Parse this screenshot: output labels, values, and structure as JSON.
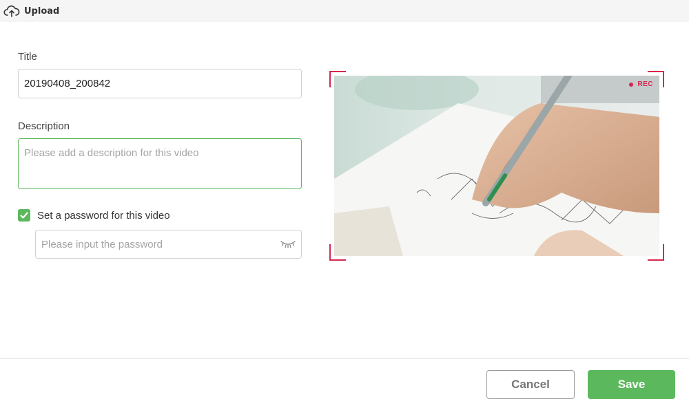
{
  "header": {
    "title": "Upload",
    "icon": "cloud-upload-icon"
  },
  "form": {
    "title_label": "Title",
    "title_value": "20190408_200842",
    "description_label": "Description",
    "description_placeholder": "Please add a description for this video",
    "password_checkbox_label": "Set a password for this video",
    "password_checked": true,
    "password_placeholder": "Please input the password"
  },
  "preview": {
    "rec_label": "REC"
  },
  "footer": {
    "cancel_label": "Cancel",
    "save_label": "Save"
  },
  "colors": {
    "accent": "#5cb85c",
    "rec": "#d6274f",
    "header_bg": "#f5f5f5"
  }
}
